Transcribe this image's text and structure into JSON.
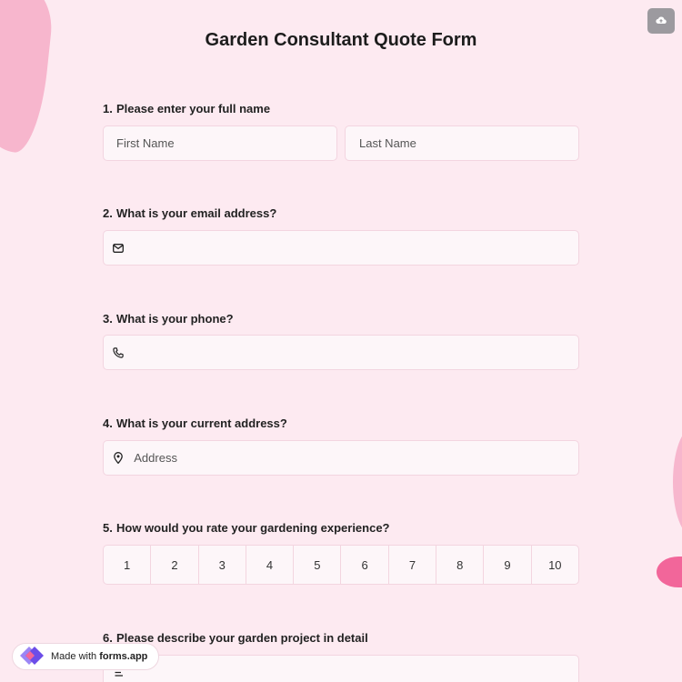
{
  "form": {
    "title": "Garden Consultant Quote Form"
  },
  "questions": [
    {
      "number": "1.",
      "label": "Please enter your full name"
    },
    {
      "number": "2.",
      "label": "What is your email address?"
    },
    {
      "number": "3.",
      "label": "What is your phone?"
    },
    {
      "number": "4.",
      "label": "What is your current address?"
    },
    {
      "number": "5.",
      "label": "How would you rate your gardening experience?"
    },
    {
      "number": "6.",
      "label": "Please describe your garden project in detail"
    }
  ],
  "fields": {
    "first_name_placeholder": "First Name",
    "last_name_placeholder": "Last Name",
    "email_placeholder": "",
    "phone_placeholder": "",
    "address_placeholder": "Address"
  },
  "rating": [
    "1",
    "2",
    "3",
    "4",
    "5",
    "6",
    "7",
    "8",
    "9",
    "10"
  ],
  "badge": {
    "prefix": "Made with",
    "brand": "forms.app"
  },
  "icons": {
    "save": "cloud-upload-icon",
    "email": "envelope-icon",
    "phone": "phone-icon",
    "address": "map-pin-icon",
    "description": "text-align-left-icon",
    "brand": "forms-app-logo"
  },
  "colors": {
    "background": "#fdeaf1",
    "field_bg": "#fdf6f9",
    "field_border": "#f3d5e0",
    "accent_pink": "#f2669a",
    "blob_pink": "#f7b6cd",
    "save_button": "#9c9a9f",
    "brand_purple": "#7b5cf0"
  }
}
